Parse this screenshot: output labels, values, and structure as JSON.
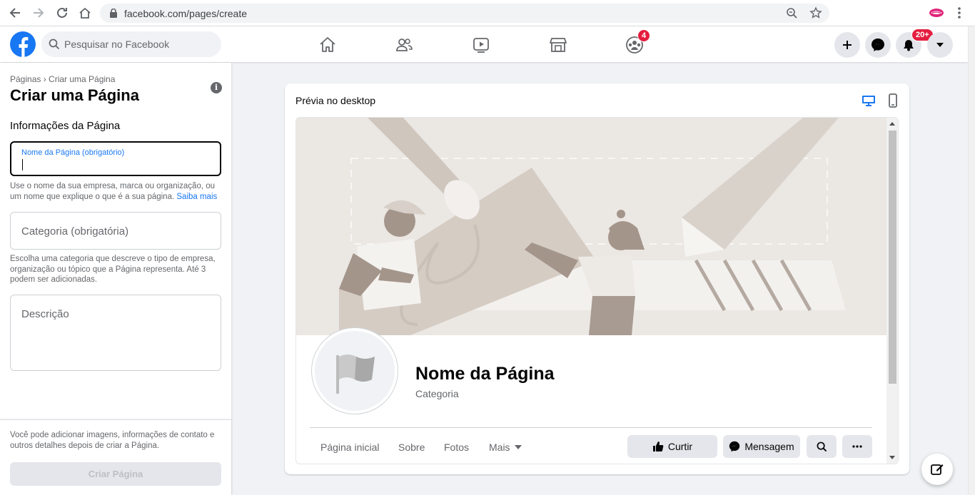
{
  "browser": {
    "url": "facebook.com/pages/create"
  },
  "header": {
    "search_placeholder": "Pesquisar no Facebook",
    "groups_badge": "4",
    "notifications_badge": "20+"
  },
  "left_panel": {
    "breadcrumb": "Páginas › Criar uma Página",
    "title": "Criar uma Página",
    "section_title": "Informações da Página",
    "name_field_label": "Nome da Página (obrigatório)",
    "name_helper": "Use o nome da sua empresa, marca ou organização, ou um nome que explique o que é a sua página.",
    "name_helper_link": "Saiba mais",
    "category_placeholder": "Categoria (obrigatória)",
    "category_helper": "Escolha uma categoria que descreve o tipo de empresa, organização ou tópico que a Página representa. Até 3 podem ser adicionadas.",
    "description_placeholder": "Descrição",
    "footer_note": "Você pode adicionar imagens, informações de contato e outros detalhes depois de criar a Página.",
    "create_button": "Criar Página"
  },
  "preview": {
    "label": "Prévia no desktop",
    "page_name": "Nome da Página",
    "category": "Categoria",
    "tabs": [
      "Página inicial",
      "Sobre",
      "Fotos",
      "Mais"
    ],
    "like_button": "Curtir",
    "message_button": "Mensagem"
  },
  "colors": {
    "brand": "#1877f2",
    "badge": "#e41e3f",
    "cover_bg": "#e9e5e1"
  }
}
